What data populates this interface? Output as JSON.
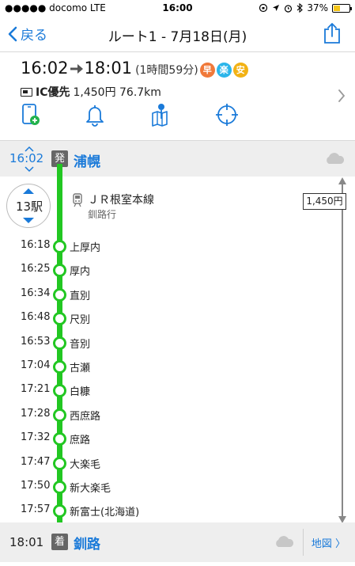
{
  "status_bar": {
    "carrier": "●●●●● docomo  LTE",
    "time": "16:00",
    "battery": "37%",
    "battery_level": 0.37
  },
  "nav": {
    "back_label": "戻る",
    "title": "ルート1 - 7月18日(月)"
  },
  "summary": {
    "depart_time": "16:02",
    "arrive_time": "18:01",
    "duration": "(1時間59分)",
    "badges": [
      {
        "label": "早",
        "color": "#f0793a"
      },
      {
        "label": "楽",
        "color": "#2bb5ea"
      },
      {
        "label": "安",
        "color": "#f2b215"
      }
    ],
    "ic_label": "IC優先",
    "fare_distance": "1,450円 76.7km"
  },
  "departure": {
    "time": "16:02",
    "badge": "発",
    "station": "浦幌"
  },
  "segment": {
    "stop_count": "13駅",
    "line_name": "ＪＲ根室本線",
    "destination": "釧路行",
    "fare": "1,450円"
  },
  "stops": [
    {
      "time": "16:18",
      "name": "上厚内"
    },
    {
      "time": "16:25",
      "name": "厚内"
    },
    {
      "time": "16:34",
      "name": "直別"
    },
    {
      "time": "16:48",
      "name": "尺別"
    },
    {
      "time": "16:53",
      "name": "音別"
    },
    {
      "time": "17:04",
      "name": "古瀬"
    },
    {
      "time": "17:21",
      "name": "白糠"
    },
    {
      "time": "17:28",
      "name": "西庶路"
    },
    {
      "time": "17:32",
      "name": "庶路"
    },
    {
      "time": "17:47",
      "name": "大楽毛"
    },
    {
      "time": "17:50",
      "name": "新大楽毛"
    },
    {
      "time": "17:57",
      "name": "新富士(北海道)"
    }
  ],
  "arrival": {
    "time": "18:01",
    "badge": "着",
    "station": "釧路",
    "map_label": "地図 〉"
  },
  "colors": {
    "accent": "#1a7ad9",
    "route_line": "#22c722"
  }
}
